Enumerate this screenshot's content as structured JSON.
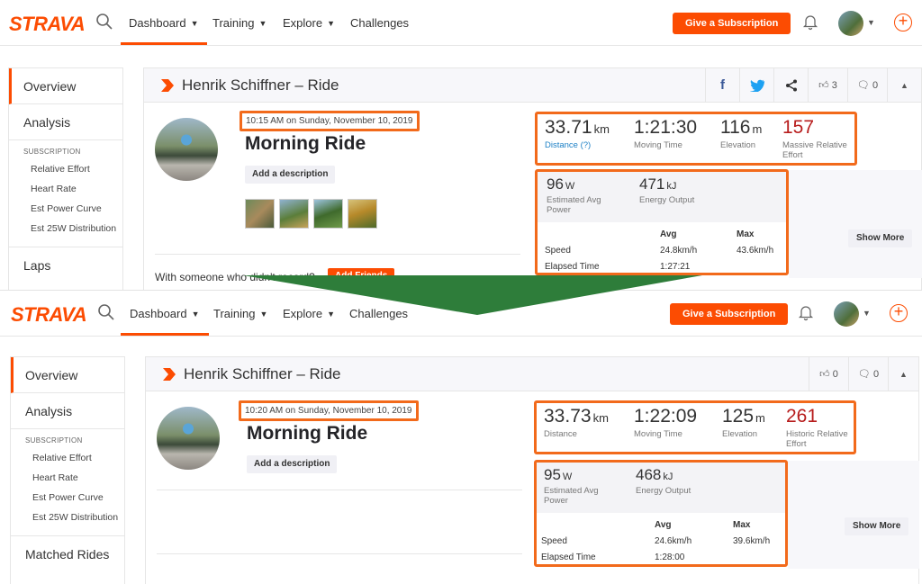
{
  "top": {
    "nav": {
      "logo": "STRAVA",
      "items": [
        {
          "label": "Dashboard"
        },
        {
          "label": "Training"
        },
        {
          "label": "Explore"
        },
        {
          "label": "Challenges"
        }
      ],
      "subscribe": "Give a Subscription"
    },
    "sidebar": {
      "overview": "Overview",
      "analysis": "Analysis",
      "sub_heading": "SUBSCRIPTION",
      "sub_items": [
        "Relative Effort",
        "Heart Rate",
        "Est Power Curve",
        "Est 25W Distribution"
      ],
      "laps": "Laps"
    },
    "header": {
      "title": "Henrik Schiffner – Ride",
      "kudos": "3",
      "comments": "0"
    },
    "date": "10:15 AM on Sunday, November 10, 2019",
    "name": "Morning Ride",
    "add_description": "Add a description",
    "with_text": "With someone who didn't record?",
    "add_friends": "Add Friends",
    "stats": [
      {
        "value": "33.71",
        "unit": "km",
        "label": "Distance (?)"
      },
      {
        "value": "1:21:30",
        "unit": "",
        "label": "Moving Time"
      },
      {
        "value": "116",
        "unit": "m",
        "label": "Elevation"
      },
      {
        "value": "157",
        "unit": "",
        "label": "Massive Relative Effort"
      }
    ],
    "power": [
      {
        "value": "96",
        "unit": "W",
        "label": "Estimated Avg Power"
      },
      {
        "value": "471",
        "unit": "kJ",
        "label": "Energy Output"
      }
    ],
    "table": {
      "avg_h": "Avg",
      "max_h": "Max",
      "speed": "Speed",
      "speed_avg": "24.8km/h",
      "speed_max": "43.6km/h",
      "elapsed": "Elapsed Time",
      "elapsed_val": "1:27:21"
    },
    "show_more": "Show More"
  },
  "bottom": {
    "nav": {
      "logo": "STRAVA",
      "items": [
        {
          "label": "Dashboard"
        },
        {
          "label": "Training"
        },
        {
          "label": "Explore"
        },
        {
          "label": "Challenges"
        }
      ],
      "subscribe": "Give a Subscription"
    },
    "sidebar": {
      "overview": "Overview",
      "analysis": "Analysis",
      "sub_heading": "SUBSCRIPTION",
      "sub_items": [
        "Relative Effort",
        "Heart Rate",
        "Est Power Curve",
        "Est 25W Distribution"
      ],
      "matched": "Matched Rides"
    },
    "header": {
      "title": "Henrik Schiffner – Ride",
      "kudos": "0",
      "comments": "0"
    },
    "date": "10:20 AM on Sunday, November 10, 2019",
    "name": "Morning Ride",
    "add_description": "Add a description",
    "stats": [
      {
        "value": "33.73",
        "unit": "km",
        "label": "Distance"
      },
      {
        "value": "1:22:09",
        "unit": "",
        "label": "Moving Time"
      },
      {
        "value": "125",
        "unit": "m",
        "label": "Elevation"
      },
      {
        "value": "261",
        "unit": "",
        "label": "Historic Relative Effort"
      }
    ],
    "power": [
      {
        "value": "95",
        "unit": "W",
        "label": "Estimated Avg Power"
      },
      {
        "value": "468",
        "unit": "kJ",
        "label": "Energy Output"
      }
    ],
    "table": {
      "avg_h": "Avg",
      "max_h": "Max",
      "speed": "Speed",
      "speed_avg": "24.6km/h",
      "speed_max": "39.6km/h",
      "elapsed": "Elapsed Time",
      "elapsed_val": "1:28:00"
    },
    "show_more": "Show More"
  },
  "colors": {
    "brand": "#fc4c02",
    "highlight": "#f26a1b",
    "arrow": "#2e7d3a",
    "effort": "#b71c1c",
    "link": "#1e81c6"
  }
}
